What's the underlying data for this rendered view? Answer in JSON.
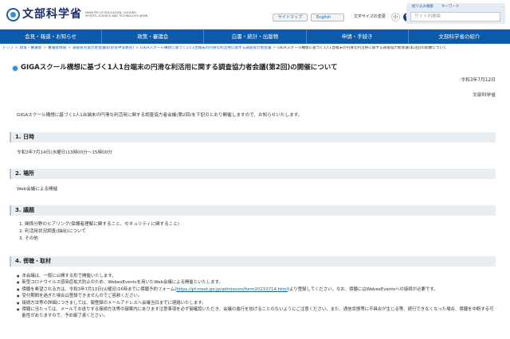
{
  "header": {
    "logo_text": "文部科学省",
    "logo_en": "MINISTRY OF EDUCATION, CULTURE, SPORTS, SCIENCE AND TECHNOLOGY-JAPAN",
    "sitemap": "サイトマップ",
    "english": "English",
    "font_size_label": "文字サイズの変更",
    "font_small": "小",
    "font_medium": "中",
    "font_large": "大",
    "search_link_1": "絞り込み検索",
    "search_link_2": "キーワード",
    "search_placeholder": "サイト内検索"
  },
  "nav": {
    "items": [
      "会見・報道・お知らせ",
      "政策・審議会",
      "白書・統計・出版物",
      "申請・手続き",
      "文部科学省の紹介"
    ]
  },
  "breadcrumb": [
    "トップ",
    "政策・審議会",
    "審議会情報",
    "調査研究協力者会議等(初等中等教育)",
    "GIGAスクール構想に基づく1人1台端末の円滑な利活用に関する調査協力者会議",
    "GIGAスクール構想に基づく1人1台端末の円滑な利活用に関する調査協力者会議(第2回)の開催について"
  ],
  "page": {
    "title": "GIGAスクール構想に基づく1人1台端末の円滑な利活用に関する調査協力者会議(第2回)の開催について",
    "date": "令和3年7月12日",
    "ministry": "文部科学省",
    "intro": "GIGAスクール構想に基づく1人1台端末の円滑な利活用に関する調査協力者会議(第2回)を下記のとおり開催しますので、お知らせいたします。"
  },
  "sections": {
    "s1_title": "1. 日時",
    "s1_body": "令和3年7月14日(水曜日)13時00分～15時00分",
    "s2_title": "2. 場所",
    "s2_body": "Web会議による開催",
    "s3_title": "3. 議題",
    "s3_items": [
      "1. 関係分野のヒアリング(保護者理解に関すること、セキュリティに関すること)",
      "2. 利活用状況調査(抽出)について",
      "3. その他"
    ],
    "s4_title": "4. 傍聴・取材",
    "s4_bullets": [
      "本会議は、一般に公開する形で開催いたします。",
      "新型コロナウイルス感染症拡大防止のため、WebexEventsを用いたWeb会議による開催といたします。",
      "傍聴を希望される方は、令和3年7月13日(火曜日)16時までに傍聴予約フォーム(",
      "受付期間を過ぎた場合は登録できませんのでご容赦ください。",
      "接続方法等の詳細につきましては、御登録のメールアドレスへ会議当日までに連絡いたします。",
      "傍聴に当たっては、メールでお送りする接続方法等の御案内にあります注意事項を必ず御確認いただき、会議の進行を妨げることのないようにご注意ください。また、通信状態等に不具合が生じる等、続行できなくなった場合、傍聴を中断する可能性がありますので、予め御了承ください。"
    ],
    "s4_link": "https://pf.mext.go.jp/admission/form20210714.html",
    "s4_link_after": ")より登録してください。なお、傍聴にはWebexEventsへの接続が必要です。"
  }
}
